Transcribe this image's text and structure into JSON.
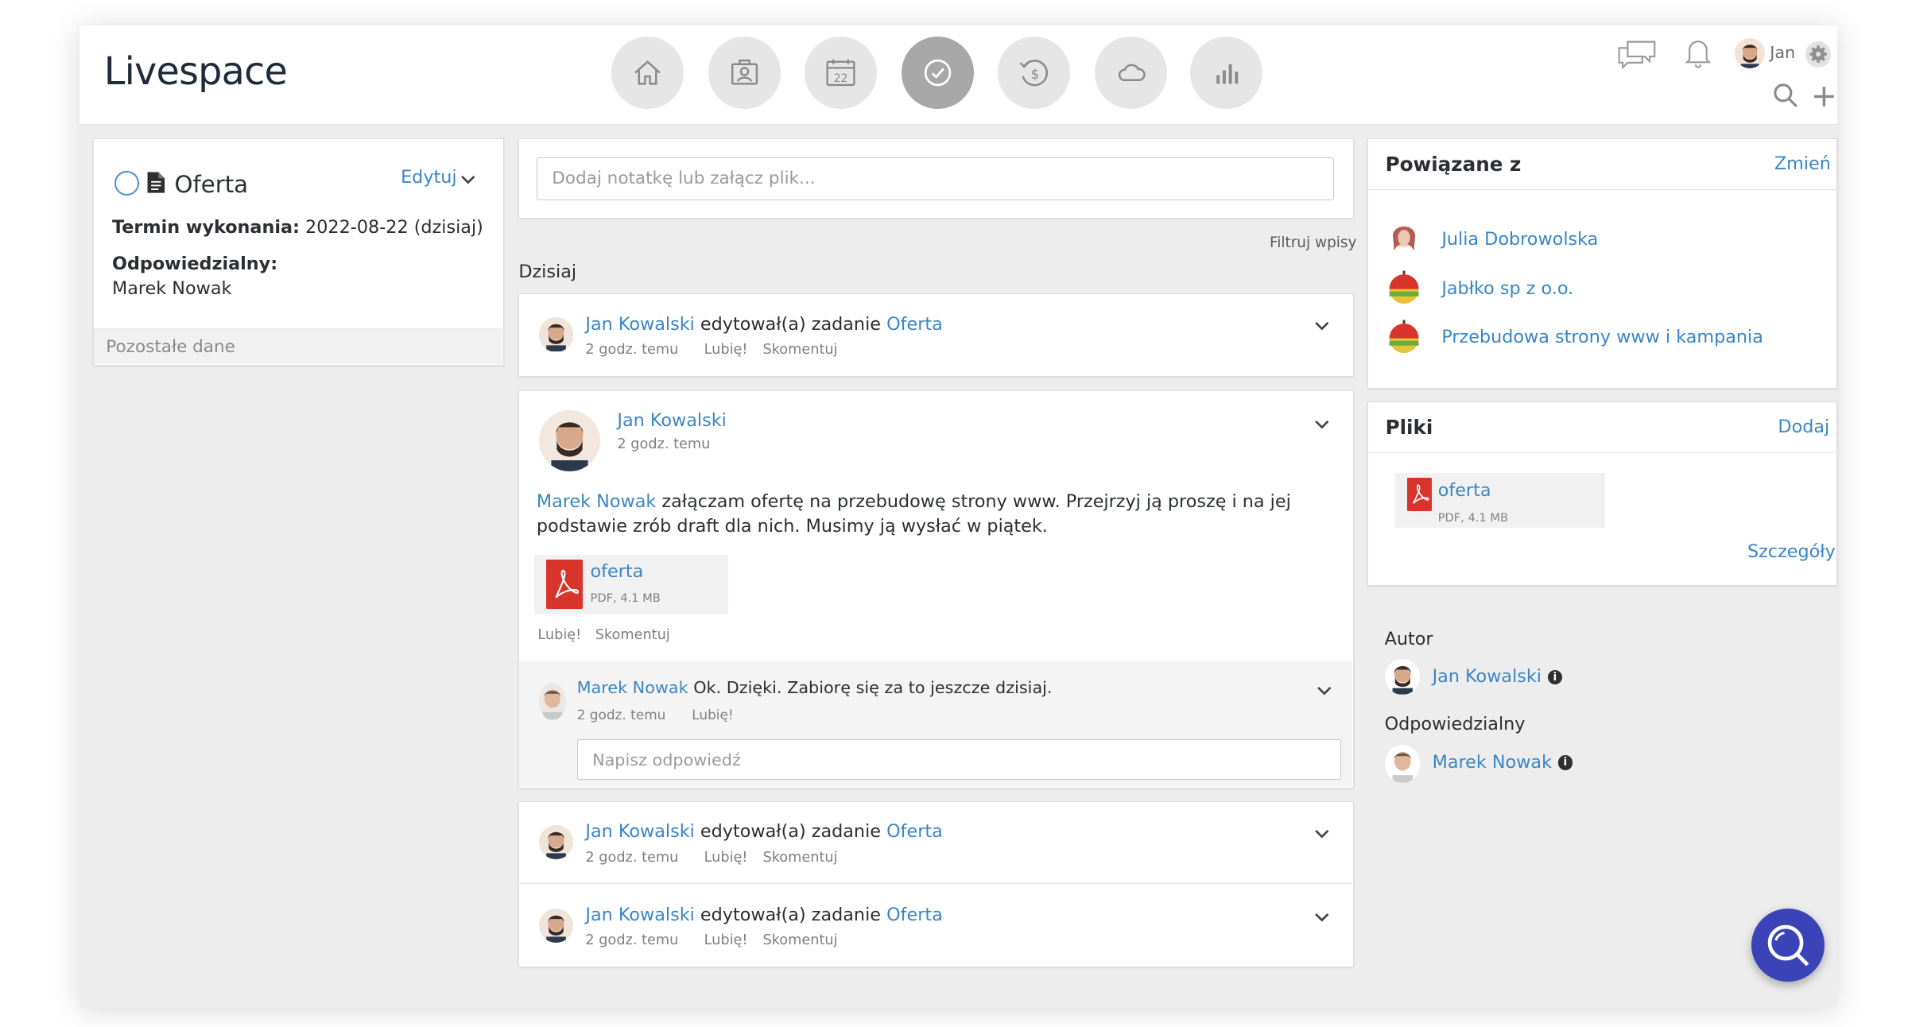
{
  "brand": {
    "logo": "Livespace"
  },
  "nav": {
    "items": [
      {
        "icon": "home-icon"
      },
      {
        "icon": "contacts-icon"
      },
      {
        "icon": "calendar-icon",
        "text": "22"
      },
      {
        "icon": "tasks-icon"
      },
      {
        "icon": "deals-icon"
      },
      {
        "icon": "cloud-icon"
      },
      {
        "icon": "reports-icon"
      }
    ]
  },
  "user_menu": {
    "name": "Jan"
  },
  "task": {
    "title": "Oferta",
    "edit_label": "Edytuj",
    "deadline_label": "Termin wykonania:",
    "deadline_value": "2022-08-22 (dzisiaj)",
    "responsible_label": "Odpowiedzialny:",
    "responsible_value": "Marek Nowak",
    "more_label": "Pozostałe dane"
  },
  "note": {
    "placeholder": "Dodaj notatkę lub załącz plik..."
  },
  "feed": {
    "filter_label": "Filtruj wpisy",
    "day_label": "Dzisiaj",
    "entries": [
      {
        "user": "Jan Kowalski",
        "action": " edytował(a) zadanie ",
        "object": "Oferta",
        "time": "2 godz. temu",
        "like": "Lubię!",
        "comment": "Skomentuj"
      }
    ],
    "post": {
      "user": "Jan Kowalski",
      "time": "2 godz. temu",
      "mention": "Marek Nowak",
      "text": " załączam ofertę na przebudowę strony www. Przejrzyj ją proszę i na jej podstawie zrób draft dla nich. Musimy ją wysłać w piątek.",
      "file_name": "oferta",
      "file_meta": "PDF, 4.1 MB",
      "like": "Lubię!",
      "comment": "Skomentuj",
      "reply": {
        "user": "Marek Nowak",
        "text": " Ok. Dzięki. Zabiorę się za to jeszcze dzisiaj.",
        "time": "2 godz. temu",
        "like": "Lubię!"
      },
      "reply_placeholder": "Napisz odpowiedź"
    },
    "entries_bottom": [
      {
        "user": "Jan Kowalski",
        "action": " edytował(a) zadanie ",
        "object": "Oferta",
        "time": "2 godz. temu",
        "like": "Lubię!",
        "comment": "Skomentuj"
      },
      {
        "user": "Jan Kowalski",
        "action": " edytował(a) zadanie ",
        "object": "Oferta",
        "time": "2 godz. temu",
        "like": "Lubię!",
        "comment": "Skomentuj"
      }
    ]
  },
  "related": {
    "title": "Powiązane z",
    "action": "Zmień",
    "items": [
      {
        "label": "Julia Dobrowolska",
        "icon": "person-icon"
      },
      {
        "label": "Jabłko sp z o.o.",
        "icon": "company-icon"
      },
      {
        "label": "Przebudowa strony www i kampania",
        "icon": "deal-icon"
      }
    ]
  },
  "files": {
    "title": "Pliki",
    "action": "Dodaj",
    "file_name": "oferta",
    "file_meta": "PDF, 4.1 MB",
    "details": "Szczegóły"
  },
  "people": {
    "author_label": "Autor",
    "author_name": "Jan Kowalski",
    "responsible_label": "Odpowiedzialny",
    "responsible_name": "Marek Nowak"
  },
  "colors": {
    "link": "#3a86c5",
    "fab": "#3a44b8",
    "pdf": "#d9342b",
    "active_nav": "#a8a8a8"
  }
}
